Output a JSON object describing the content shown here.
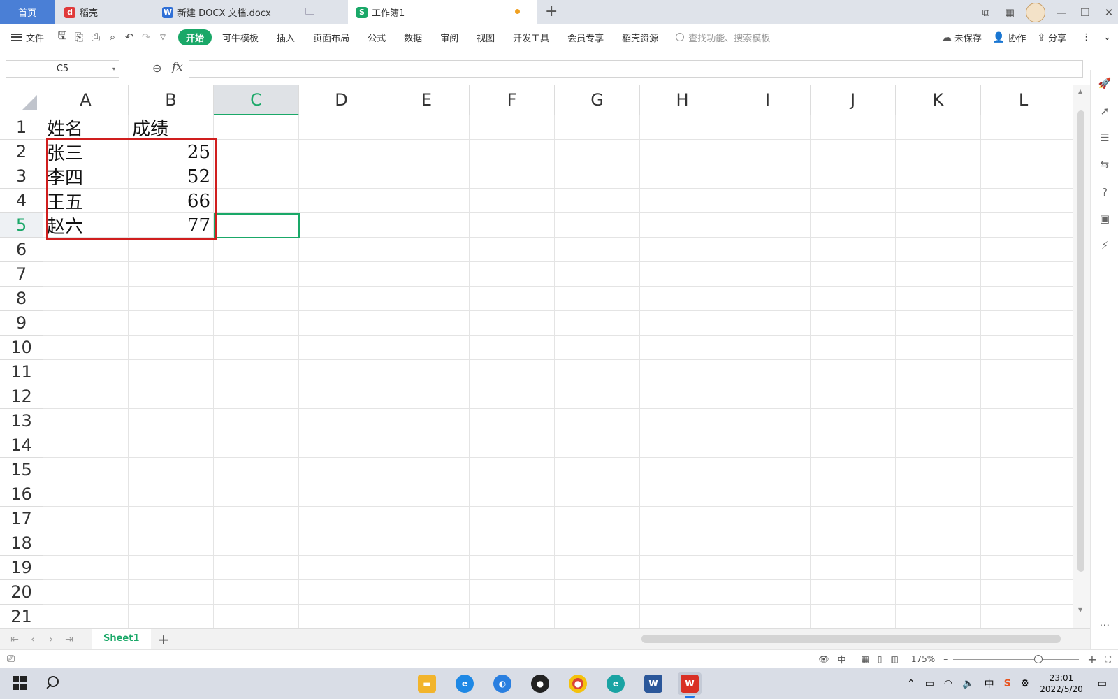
{
  "tabs": {
    "home": "首页",
    "daoke": "稻壳",
    "docx": "新建 DOCX 文档.docx",
    "workbook": "工作簿1",
    "new_tab": "+"
  },
  "ribbon": {
    "file_menu": "文件",
    "tabs": [
      "开始",
      "可牛模板",
      "插入",
      "页面布局",
      "公式",
      "数据",
      "审阅",
      "视图",
      "开发工具",
      "会员专享",
      "稻壳资源"
    ],
    "active_tab": "开始",
    "search_placeholder": "查找功能、搜索模板",
    "unsaved": "未保存",
    "collaborate": "协作",
    "share": "分享"
  },
  "formula_bar": {
    "name_box": "C5",
    "fx": "fx",
    "value": ""
  },
  "sheet": {
    "columns": [
      "A",
      "B",
      "C",
      "D",
      "E",
      "F",
      "G",
      "H",
      "I",
      "J",
      "K",
      "L"
    ],
    "selected_column": "C",
    "rows": [
      "1",
      "2",
      "3",
      "4",
      "5",
      "6",
      "7",
      "8",
      "9",
      "10",
      "11",
      "12",
      "13",
      "14",
      "15",
      "16",
      "17",
      "18",
      "19",
      "20",
      "21"
    ],
    "selected_row": "5",
    "cells": {
      "A1": "姓名",
      "B1": "成绩",
      "A2": "张三",
      "B2": "25",
      "A3": "李四",
      "B3": "52",
      "A4": "王五",
      "B4": "66",
      "A5": "赵六",
      "B5": "77"
    },
    "active_cell": "C5"
  },
  "sheet_tabs": {
    "names": [
      "Sheet1"
    ],
    "active": "Sheet1",
    "add": "+"
  },
  "status_bar": {
    "zoom": "175%",
    "zoom_minus": "–",
    "zoom_plus": "+"
  },
  "taskbar": {
    "time": "23:01",
    "date": "2022/5/20",
    "ime": "中"
  },
  "colors": {
    "accent": "#1aa868",
    "highlight_box": "#d01e1e",
    "home_tab": "#4a7fd6"
  }
}
